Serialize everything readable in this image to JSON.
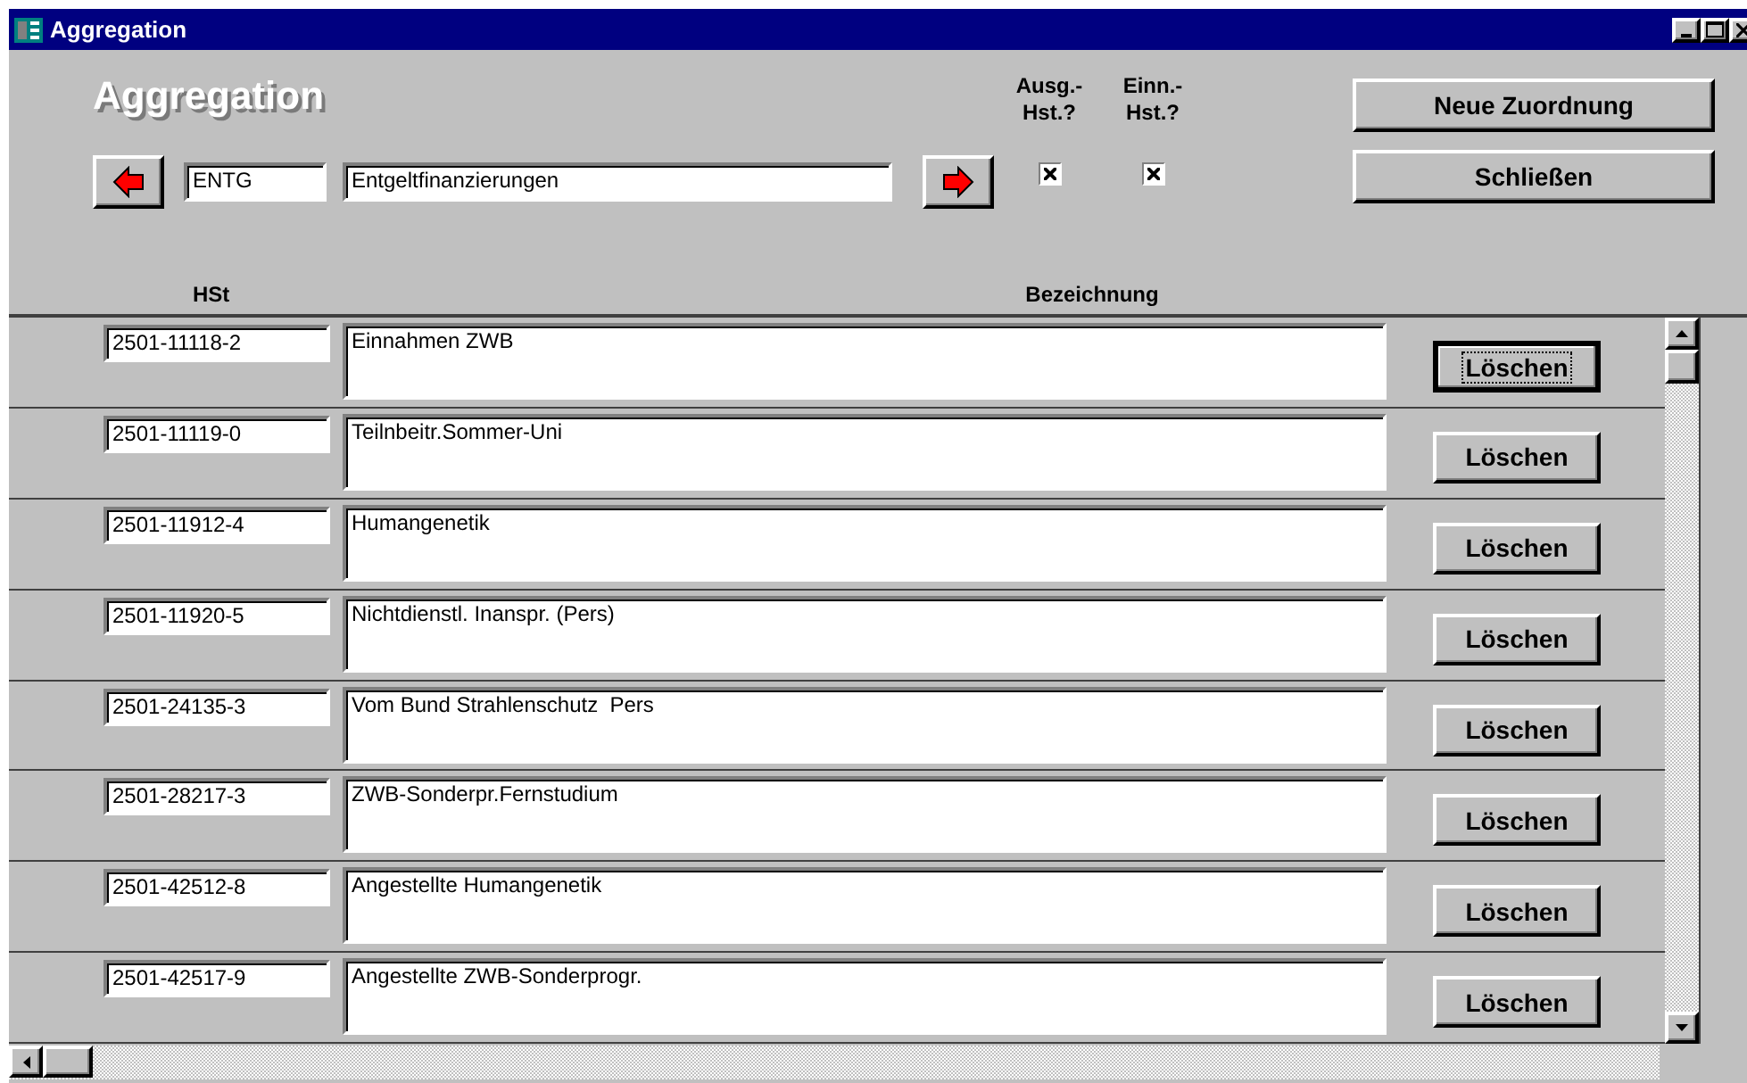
{
  "window": {
    "title": "Aggregation"
  },
  "form": {
    "heading": "Aggregation",
    "code": "ENTG",
    "name": "Entgeltfinanzierungen",
    "checks": [
      {
        "label": "Ausg.- Hst.?",
        "checked": true
      },
      {
        "label": "Einn.- Hst.?",
        "checked": true
      }
    ],
    "buttons": [
      {
        "label": "Neue Zuordnung"
      },
      {
        "label": "Schließen"
      }
    ]
  },
  "columns": [
    "HSt",
    "Bezeichnung"
  ],
  "rows": [
    {
      "hst": "2501-11118-2",
      "bezeichnung": "Einnahmen ZWB",
      "button": "Löschen",
      "focused": true
    },
    {
      "hst": "2501-11119-0",
      "bezeichnung": "Teilnbeitr.Sommer-Uni",
      "button": "Löschen",
      "focused": false
    },
    {
      "hst": "2501-11912-4",
      "bezeichnung": "Humangenetik",
      "button": "Löschen",
      "focused": false
    },
    {
      "hst": "2501-11920-5",
      "bezeichnung": "Nichtdienstl. Inanspr. (Pers)",
      "button": "Löschen",
      "focused": false
    },
    {
      "hst": "2501-24135-3",
      "bezeichnung": "Vom Bund Strahlenschutz  Pers",
      "button": "Löschen",
      "focused": false
    },
    {
      "hst": "2501-28217-3",
      "bezeichnung": "ZWB-Sonderpr.Fernstudium",
      "button": "Löschen",
      "focused": false
    },
    {
      "hst": "2501-42512-8",
      "bezeichnung": "Angestellte Humangenetik",
      "button": "Löschen",
      "focused": false
    },
    {
      "hst": "2501-42517-9",
      "bezeichnung": "Angestellte ZWB-Sonderprogr.",
      "button": "Löschen",
      "focused": false
    }
  ]
}
